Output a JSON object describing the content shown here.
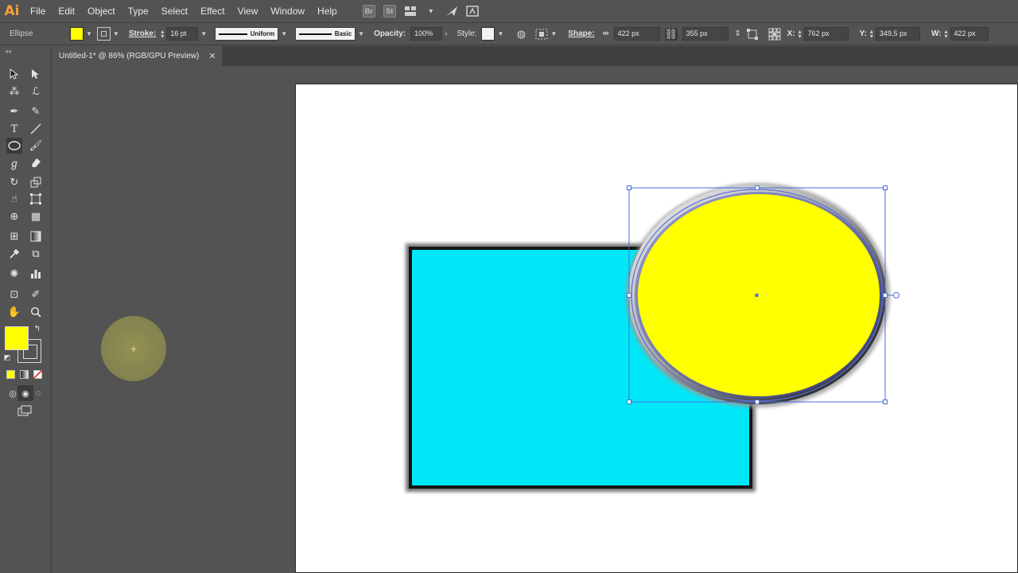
{
  "app": {
    "logo": "Ai"
  },
  "menu": {
    "items": [
      "File",
      "Edit",
      "Object",
      "Type",
      "Select",
      "Effect",
      "View",
      "Window",
      "Help"
    ],
    "extras": {
      "bridge": "Br",
      "stock": "St"
    }
  },
  "controlbar": {
    "selection_type": "Ellipse",
    "fill_color": "#ffff00",
    "stroke_label": "Stroke:",
    "stroke_value": "16 pt",
    "profile_label": "Uniform",
    "brush_label": "Basic",
    "opacity_label": "Opacity:",
    "opacity_value": "100%",
    "style_label": "Style:",
    "shape_label": "Shape:",
    "shape_width": "422 px",
    "shape_height": "355 px",
    "x_label": "X:",
    "x_value": "762 px",
    "y_label": "Y:",
    "y_value": "349,5 px",
    "w_label": "W:",
    "w_value": "422 px"
  },
  "document": {
    "tab_title": "Untitled-1* @ 86% (RGB/GPU Preview)",
    "close_glyph": "✕"
  },
  "colors": {
    "fill": "#ffff00",
    "rectangle": "#00e8f8",
    "selection": "#4a6ee0",
    "ui_bg": "#535353"
  },
  "icons": [
    "selection-tool-icon",
    "direct-selection-tool-icon",
    "magic-wand-icon",
    "lasso-icon",
    "pen-tool-icon",
    "curvature-tool-icon",
    "type-tool-icon",
    "line-tool-icon",
    "ellipse-tool-icon",
    "paintbrush-icon",
    "shaper-tool-icon",
    "eraser-icon",
    "rotate-tool-icon",
    "scale-tool-icon",
    "warp-tool-icon",
    "free-transform-icon",
    "shape-builder-icon",
    "perspective-grid-icon",
    "mesh-tool-icon",
    "gradient-tool-icon",
    "eyedropper-icon",
    "blend-tool-icon",
    "symbol-sprayer-icon",
    "column-graph-icon",
    "artboard-tool-icon",
    "slice-tool-icon",
    "hand-tool-icon",
    "zoom-tool-icon"
  ]
}
